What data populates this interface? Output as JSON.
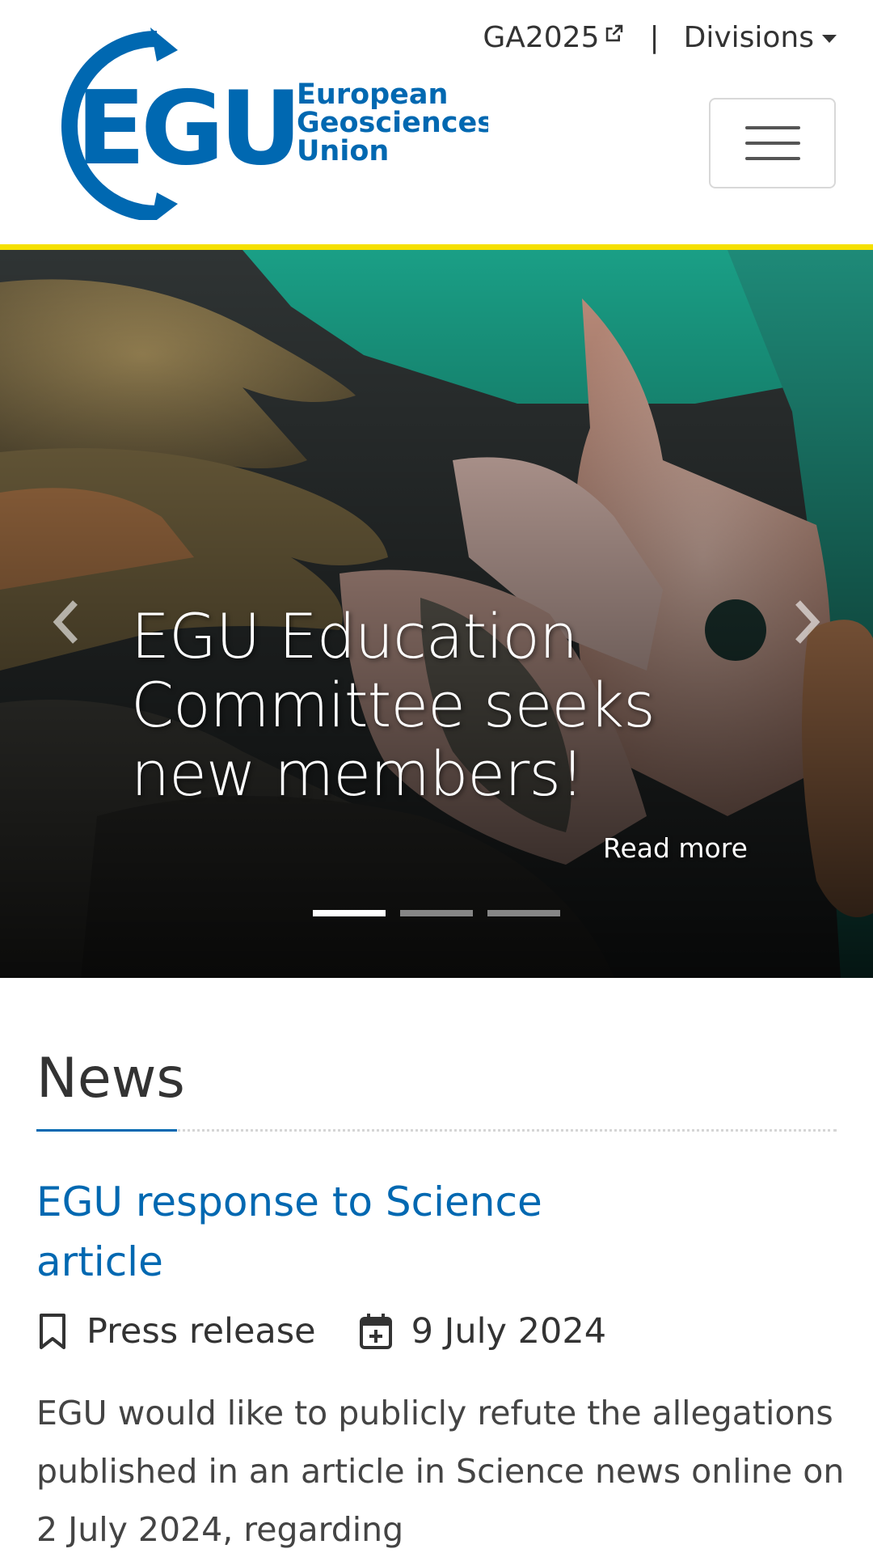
{
  "header": {
    "logo": {
      "mark": "EGU",
      "line1": "European",
      "line2": "Geosciences",
      "line3": "Union"
    },
    "links": {
      "ga": "GA2025",
      "separator": "|",
      "divisions": "Divisions"
    },
    "colors": {
      "brand_blue": "#0068b1",
      "accent_yellow": "#f5e000"
    }
  },
  "carousel": {
    "title": "EGU Education Committee seeks new members!",
    "read_more": "Read more",
    "active_slide": 1,
    "slide_count": 3
  },
  "news": {
    "heading": "News",
    "article": {
      "title": "EGU response to Science article",
      "category": "Press release",
      "date": "9 July 2024",
      "excerpt": "EGU would like to publicly refute the allegations published in an article in Science news online on 2 July 2024, regarding"
    }
  }
}
